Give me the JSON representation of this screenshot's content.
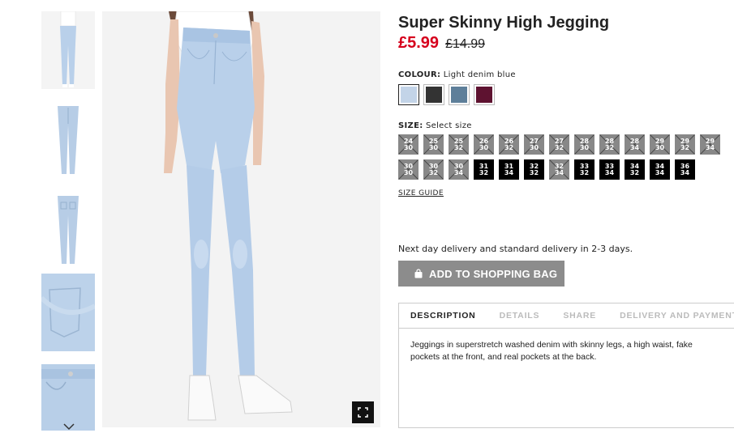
{
  "product": {
    "title": "Super Skinny High Jegging",
    "price_now": "£5.99",
    "price_old": "£14.99"
  },
  "colour": {
    "label": "COLOUR:",
    "selected": "Light denim blue",
    "swatches": [
      {
        "name": "Light denim blue",
        "color": "#c3d4e8",
        "selected": true
      },
      {
        "name": "Black",
        "color": "#333333",
        "selected": false
      },
      {
        "name": "Denim blue",
        "color": "#5e7f9a",
        "selected": false
      },
      {
        "name": "Burgundy",
        "color": "#5e1230",
        "selected": false
      }
    ]
  },
  "size": {
    "label": "SIZE:",
    "prompt": "Select size",
    "options": [
      {
        "top": "24",
        "bottom": "30",
        "available": false
      },
      {
        "top": "25",
        "bottom": "30",
        "available": false
      },
      {
        "top": "25",
        "bottom": "32",
        "available": false
      },
      {
        "top": "26",
        "bottom": "30",
        "available": false
      },
      {
        "top": "26",
        "bottom": "32",
        "available": false
      },
      {
        "top": "27",
        "bottom": "30",
        "available": false
      },
      {
        "top": "27",
        "bottom": "32",
        "available": false
      },
      {
        "top": "28",
        "bottom": "30",
        "available": false
      },
      {
        "top": "28",
        "bottom": "32",
        "available": false
      },
      {
        "top": "28",
        "bottom": "34",
        "available": false
      },
      {
        "top": "29",
        "bottom": "30",
        "available": false
      },
      {
        "top": "29",
        "bottom": "32",
        "available": false
      },
      {
        "top": "29",
        "bottom": "34",
        "available": false
      },
      {
        "top": "30",
        "bottom": "30",
        "available": false
      },
      {
        "top": "30",
        "bottom": "32",
        "available": false
      },
      {
        "top": "30",
        "bottom": "34",
        "available": false
      },
      {
        "top": "31",
        "bottom": "32",
        "available": true
      },
      {
        "top": "31",
        "bottom": "34",
        "available": true
      },
      {
        "top": "32",
        "bottom": "32",
        "available": true
      },
      {
        "top": "32",
        "bottom": "34",
        "available": false
      },
      {
        "top": "33",
        "bottom": "32",
        "available": true
      },
      {
        "top": "33",
        "bottom": "34",
        "available": true
      },
      {
        "top": "34",
        "bottom": "32",
        "available": true
      },
      {
        "top": "34",
        "bottom": "34",
        "available": true
      },
      {
        "top": "36",
        "bottom": "34",
        "available": true
      }
    ],
    "guide": "SIZE GUIDE"
  },
  "delivery_text": "Next day delivery and standard delivery in 2-3 days.",
  "add_to_bag": "ADD TO SHOPPING BAG",
  "tabs": [
    {
      "label": "DESCRIPTION",
      "active": true
    },
    {
      "label": "DETAILS",
      "active": false
    },
    {
      "label": "SHARE",
      "active": false
    },
    {
      "label": "DELIVERY AND PAYMENT",
      "active": false
    }
  ],
  "description": "Jeggings in superstretch washed denim with skinny legs, a high waist, fake pockets at the front, and real pockets at the back.",
  "icons": {
    "bag": "shopping-bag-icon",
    "fullscreen": "fullscreen-icon",
    "down": "chevron-down-icon"
  }
}
